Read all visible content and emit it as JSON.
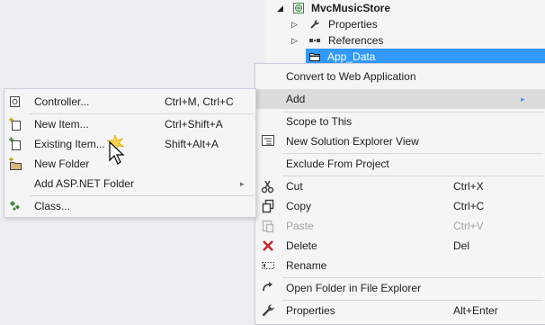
{
  "tree": {
    "root": {
      "label": "MvcMusicStore",
      "arrow": "◢",
      "icon": "web-project-icon"
    },
    "items": [
      {
        "label": "Properties",
        "arrow": "▷",
        "icon": "wrench-icon"
      },
      {
        "label": "References",
        "arrow": "▷",
        "icon": "references-icon"
      },
      {
        "label": "App_Data",
        "arrow": "",
        "icon": "folder-icon",
        "selected": true
      }
    ]
  },
  "context_menu": {
    "items": [
      {
        "label": "Convert to Web Application",
        "shortcut": "",
        "icon": ""
      },
      {
        "label": "Add",
        "shortcut": "",
        "icon": "",
        "submenu_arrow": "▸",
        "highlighted": true
      },
      {
        "label": "Scope to This",
        "shortcut": "",
        "icon": ""
      },
      {
        "label": "New Solution Explorer View",
        "shortcut": "",
        "icon": "solution-view-icon"
      },
      {
        "label": "Exclude From Project",
        "shortcut": "",
        "icon": ""
      },
      {
        "label": "Cut",
        "shortcut": "Ctrl+X",
        "icon": "scissors-icon"
      },
      {
        "label": "Copy",
        "shortcut": "Ctrl+C",
        "icon": "copy-icon"
      },
      {
        "label": "Paste",
        "shortcut": "Ctrl+V",
        "icon": "paste-icon",
        "disabled": true
      },
      {
        "label": "Delete",
        "shortcut": "Del",
        "icon": "delete-x-icon"
      },
      {
        "label": "Rename",
        "shortcut": "",
        "icon": "rename-icon"
      },
      {
        "label": "Open Folder in File Explorer",
        "shortcut": "",
        "icon": "refresh-arrow-icon"
      },
      {
        "label": "Properties",
        "shortcut": "Alt+Enter",
        "icon": "wrench-icon"
      }
    ]
  },
  "add_submenu": {
    "items": [
      {
        "label": "Controller...",
        "shortcut": "Ctrl+M, Ctrl+C",
        "icon": "controller-icon"
      },
      {
        "label": "New Item...",
        "shortcut": "Ctrl+Shift+A",
        "icon": "new-item-icon"
      },
      {
        "label": "Existing Item...",
        "shortcut": "Shift+Alt+A",
        "icon": "existing-item-icon"
      },
      {
        "label": "New Folder",
        "shortcut": "",
        "icon": "new-folder-icon"
      },
      {
        "label": "Add ASP.NET Folder",
        "shortcut": "",
        "icon": "",
        "submenu_arrow": "▸"
      },
      {
        "label": "Class...",
        "shortcut": "",
        "icon": "class-icon"
      }
    ]
  },
  "colors": {
    "selection": "#3399ff",
    "delete_red": "#c8262c",
    "menu_bg": "#f5f5f5"
  }
}
